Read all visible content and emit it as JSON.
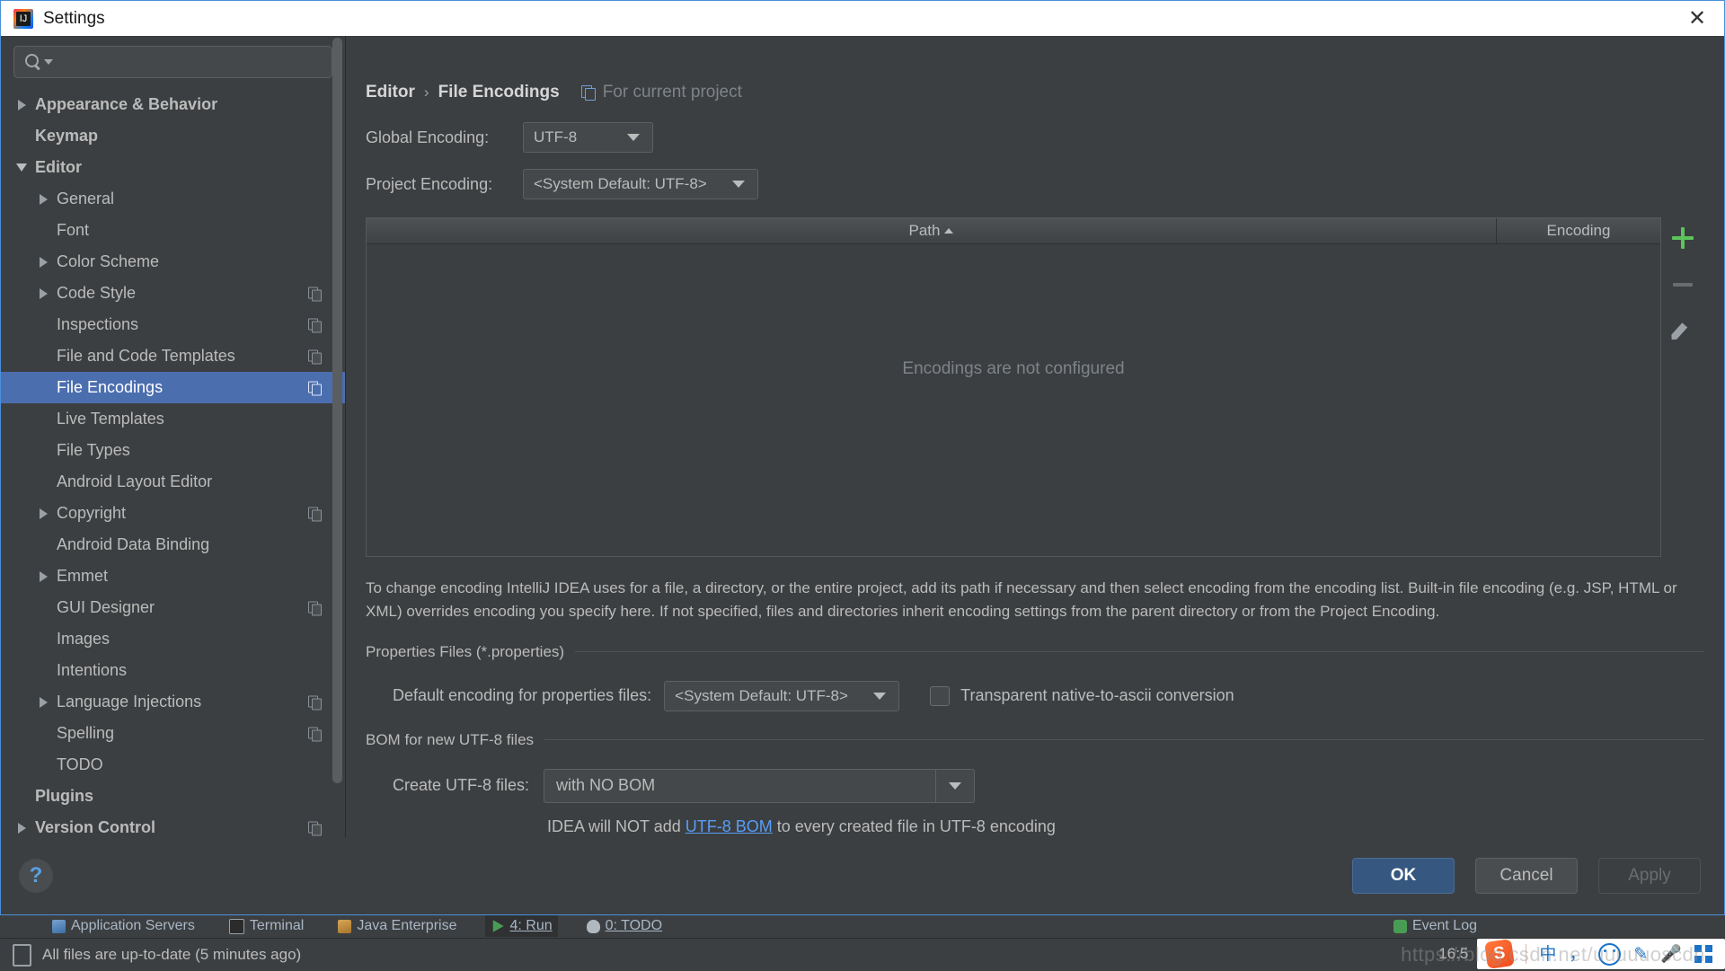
{
  "window": {
    "title": "Settings",
    "logo_icon": "intellij-idea-icon",
    "close_icon": "close-icon"
  },
  "search": {
    "value": "",
    "placeholder": "",
    "icon": "search-icon",
    "dropdown_icon": "caret-down-icon"
  },
  "sidebar": {
    "items": [
      {
        "label": "Appearance & Behavior",
        "level": 0,
        "bold": true,
        "arrow": "right",
        "copy": false,
        "selected": false
      },
      {
        "label": "Keymap",
        "level": 0,
        "bold": true,
        "arrow": "none",
        "copy": false,
        "selected": false
      },
      {
        "label": "Editor",
        "level": 0,
        "bold": true,
        "arrow": "down",
        "copy": false,
        "selected": false
      },
      {
        "label": "General",
        "level": 1,
        "bold": false,
        "arrow": "right",
        "copy": false,
        "selected": false
      },
      {
        "label": "Font",
        "level": 1,
        "bold": false,
        "arrow": "none",
        "copy": false,
        "selected": false
      },
      {
        "label": "Color Scheme",
        "level": 1,
        "bold": false,
        "arrow": "right",
        "copy": false,
        "selected": false
      },
      {
        "label": "Code Style",
        "level": 1,
        "bold": false,
        "arrow": "right",
        "copy": true,
        "selected": false
      },
      {
        "label": "Inspections",
        "level": 1,
        "bold": false,
        "arrow": "none",
        "copy": true,
        "selected": false
      },
      {
        "label": "File and Code Templates",
        "level": 1,
        "bold": false,
        "arrow": "none",
        "copy": true,
        "selected": false
      },
      {
        "label": "File Encodings",
        "level": 1,
        "bold": false,
        "arrow": "none",
        "copy": true,
        "selected": true
      },
      {
        "label": "Live Templates",
        "level": 1,
        "bold": false,
        "arrow": "none",
        "copy": false,
        "selected": false
      },
      {
        "label": "File Types",
        "level": 1,
        "bold": false,
        "arrow": "none",
        "copy": false,
        "selected": false
      },
      {
        "label": "Android Layout Editor",
        "level": 1,
        "bold": false,
        "arrow": "none",
        "copy": false,
        "selected": false
      },
      {
        "label": "Copyright",
        "level": 1,
        "bold": false,
        "arrow": "right",
        "copy": true,
        "selected": false
      },
      {
        "label": "Android Data Binding",
        "level": 1,
        "bold": false,
        "arrow": "none",
        "copy": false,
        "selected": false
      },
      {
        "label": "Emmet",
        "level": 1,
        "bold": false,
        "arrow": "right",
        "copy": false,
        "selected": false
      },
      {
        "label": "GUI Designer",
        "level": 1,
        "bold": false,
        "arrow": "none",
        "copy": true,
        "selected": false
      },
      {
        "label": "Images",
        "level": 1,
        "bold": false,
        "arrow": "none",
        "copy": false,
        "selected": false
      },
      {
        "label": "Intentions",
        "level": 1,
        "bold": false,
        "arrow": "none",
        "copy": false,
        "selected": false
      },
      {
        "label": "Language Injections",
        "level": 1,
        "bold": false,
        "arrow": "right",
        "copy": true,
        "selected": false
      },
      {
        "label": "Spelling",
        "level": 1,
        "bold": false,
        "arrow": "none",
        "copy": true,
        "selected": false
      },
      {
        "label": "TODO",
        "level": 1,
        "bold": false,
        "arrow": "none",
        "copy": false,
        "selected": false
      },
      {
        "label": "Plugins",
        "level": 0,
        "bold": true,
        "arrow": "none",
        "copy": false,
        "selected": false
      },
      {
        "label": "Version Control",
        "level": 0,
        "bold": true,
        "arrow": "right",
        "copy": true,
        "selected": false
      }
    ]
  },
  "main": {
    "breadcrumb": {
      "parent": "Editor",
      "separator": "›",
      "current": "File Encodings",
      "project_note": "For current project",
      "project_note_icon": "copy-project-icon"
    },
    "global_encoding": {
      "label": "Global Encoding:",
      "value": "UTF-8"
    },
    "project_encoding": {
      "label": "Project Encoding:",
      "value": "<System Default: UTF-8>"
    },
    "table": {
      "columns": [
        "Path",
        "Encoding"
      ],
      "sort_column": "Path",
      "sort_direction": "ascending",
      "rows": [],
      "empty_text": "Encodings are not configured",
      "toolbar": [
        {
          "name": "add",
          "icon": "plus-icon",
          "enabled": true
        },
        {
          "name": "remove",
          "icon": "minus-icon",
          "enabled": false
        },
        {
          "name": "edit",
          "icon": "pencil-icon",
          "enabled": true
        }
      ]
    },
    "description": "To change encoding IntelliJ IDEA uses for a file, a directory, or the entire project, add its path if necessary and then select encoding from the encoding list. Built-in file encoding (e.g. JSP, HTML or XML) overrides encoding you specify here. If not specified, files and directories inherit encoding settings from the parent directory or from the Project Encoding.",
    "properties_section": {
      "title": "Properties Files (*.properties)",
      "default_encoding_label": "Default encoding for properties files:",
      "default_encoding_value": "<System Default: UTF-8>",
      "transparent_checkbox_label": "Transparent native-to-ascii conversion",
      "transparent_checked": false
    },
    "bom_section": {
      "title": "BOM for new UTF-8 files",
      "create_label": "Create UTF-8 files:",
      "create_value": "with NO BOM",
      "note_prefix": "IDEA will NOT add ",
      "note_link": "UTF-8 BOM",
      "note_suffix": " to every created file in UTF-8 encoding"
    }
  },
  "footer": {
    "help_icon": "question-mark-icon",
    "ok_label": "OK",
    "cancel_label": "Cancel",
    "apply_label": "Apply",
    "apply_enabled": false
  },
  "ide_background": {
    "toolwindows": [
      {
        "label": "Application Servers",
        "icon": "application-servers-icon",
        "active": false
      },
      {
        "label": "Terminal",
        "icon": "terminal-icon",
        "active": false
      },
      {
        "label": "Java Enterprise",
        "icon": "java-enterprise-icon",
        "active": false
      },
      {
        "label": "4: Run",
        "icon": "run-icon",
        "active": true
      },
      {
        "label": "0: TODO",
        "icon": "todo-icon",
        "active": false
      },
      {
        "label": "Event Log",
        "icon": "event-log-icon",
        "active": false
      }
    ],
    "status_text": "All files are up-to-date (5 minutes ago)",
    "status_icon": "vcs-icon",
    "clock": "16:5",
    "watermark": "https://blog.csdn.net/uuuuuoscdn",
    "ime": {
      "logo": "sogou-ime-icon",
      "mode": "中",
      "punctuation": "，",
      "emoji_icon": "smiley-icon",
      "pen_icon": "handwriting-icon",
      "mic_icon": "microphone-icon",
      "qr_icon": "qr-toolbox-icon"
    }
  },
  "colors": {
    "accent_blue": "#4b6eaf",
    "primary_button": "#365880",
    "link": "#589df6",
    "panel_bg": "#3c3f41",
    "add_green": "#5bc45b"
  }
}
